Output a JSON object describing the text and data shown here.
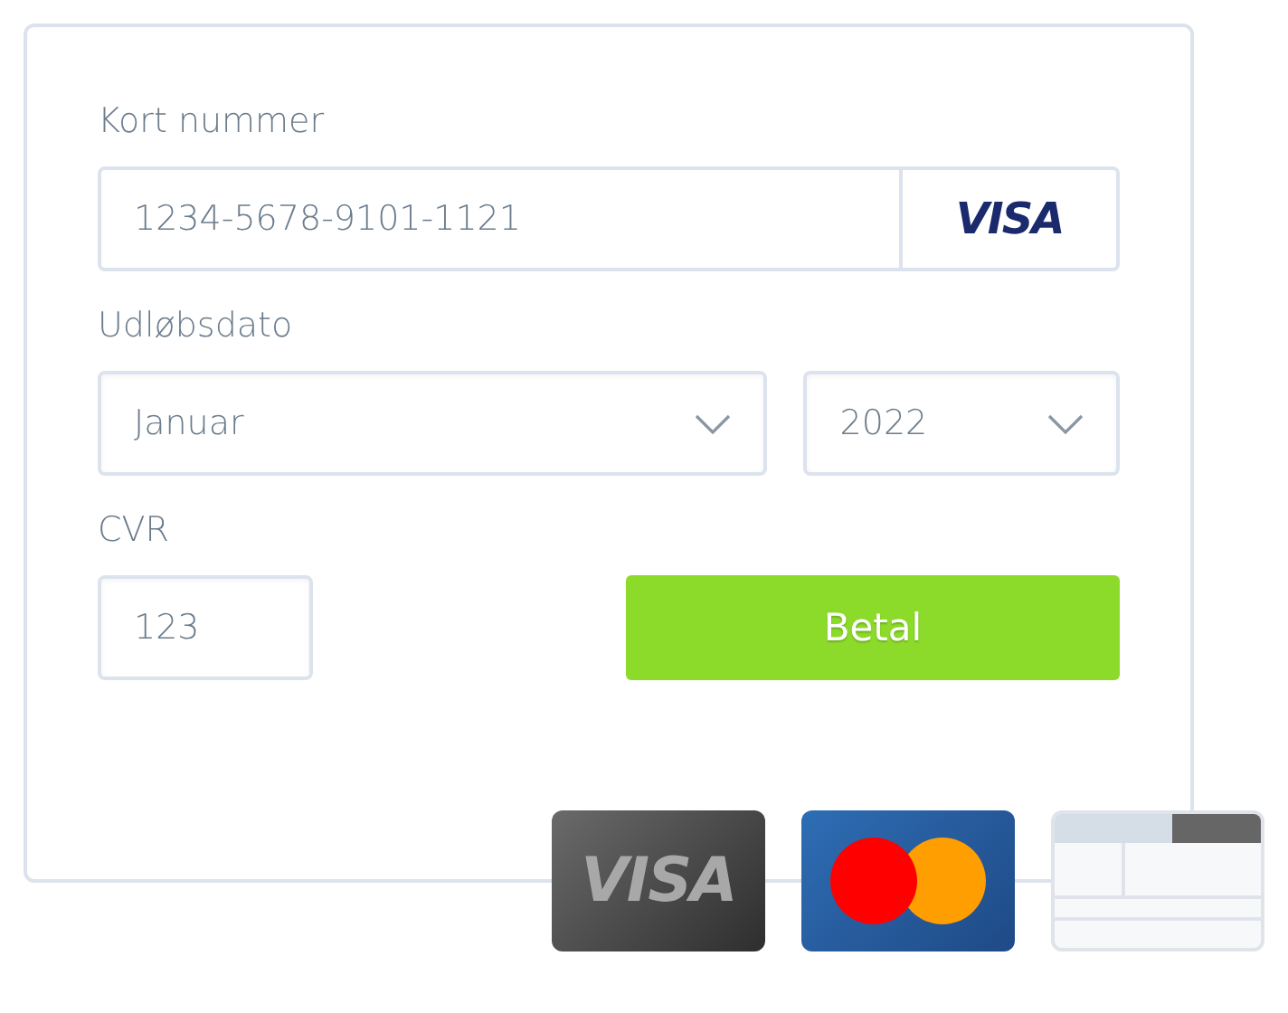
{
  "card_number": {
    "label": "Kort nummer",
    "value": "1234-5678-9101-1121",
    "brand": "VISA"
  },
  "expiry": {
    "label": "Udløbsdato",
    "month": "Januar",
    "year": "2022"
  },
  "cvr": {
    "label": "CVR",
    "value": "123"
  },
  "pay_button": "Betal",
  "card_logos": [
    {
      "kind": "visa",
      "text": "VISA"
    },
    {
      "kind": "mastercard"
    },
    {
      "kind": "generic"
    }
  ]
}
